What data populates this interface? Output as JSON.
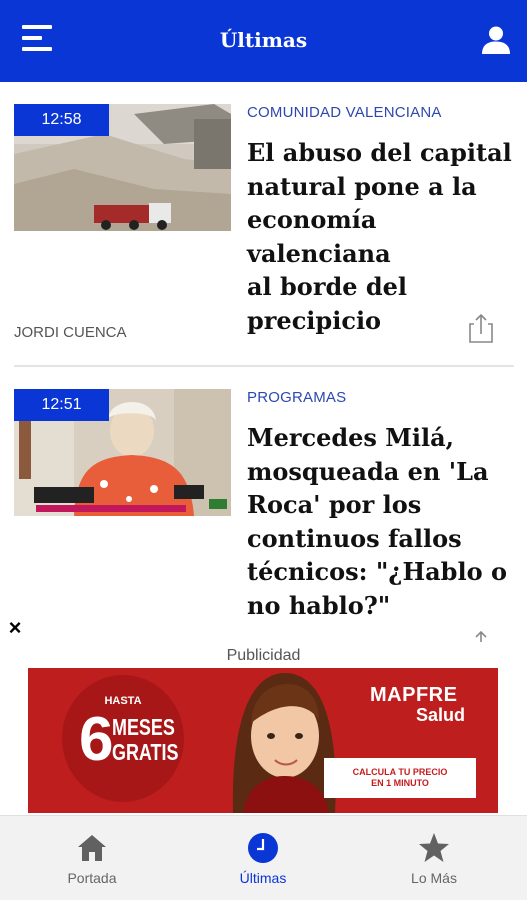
{
  "header": {
    "title": "Últimas"
  },
  "articles": [
    {
      "time": "12:58",
      "category": "COMUNIDAD VALENCIANA",
      "headline_lines": [
        "El abuso del capital",
        "natural pone a la",
        "economía valenciana",
        "al borde del",
        "precipicio"
      ],
      "author": "JORDI CUENCA"
    },
    {
      "time": "12:51",
      "category": "PROGRAMAS",
      "headline_lines": [
        "Mercedes Milá,",
        "mosqueada en 'La",
        "Roca' por los",
        "continuos fallos",
        "técnicos: \"¿Hablo o",
        "no hablo?\""
      ]
    }
  ],
  "ad": {
    "close_glyph": "×",
    "label": "Publicidad",
    "hasta": "HASTA",
    "number": "6",
    "meses": "MESES",
    "gratis": "GRATIS",
    "brand": "MAPFRE",
    "brand_sub": "Salud",
    "cta_lines": [
      "CALCULA TU PRECIO",
      "EN 1 MINUTO"
    ]
  },
  "bottom_nav": {
    "items": [
      {
        "label": "Portada",
        "icon": "home-icon",
        "active": false
      },
      {
        "label": "Últimas",
        "icon": "clock-icon",
        "active": true
      },
      {
        "label": "Lo Más",
        "icon": "star-icon",
        "active": false
      }
    ]
  },
  "colors": {
    "primary": "#0a36d6",
    "ad_red": "#bf1e1e",
    "category": "#2c49b0"
  }
}
